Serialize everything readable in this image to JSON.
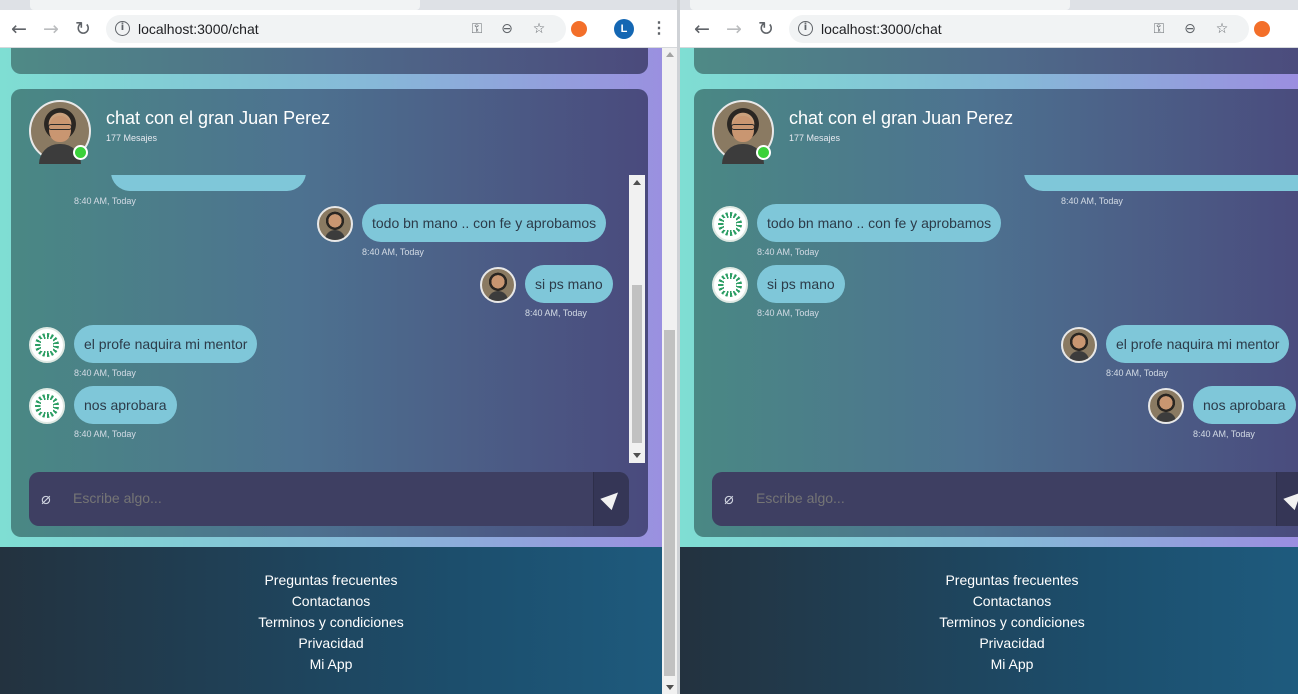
{
  "browser": {
    "url": "localhost:3000/chat",
    "profile_initial": "L",
    "icons": [
      "back-arrow-icon",
      "forward-arrow-icon",
      "reload-icon",
      "info-icon",
      "key-icon",
      "zoom-out-icon",
      "star-icon",
      "extension-icon",
      "menu-icon"
    ]
  },
  "chat": {
    "title": "chat con el gran Juan Perez",
    "message_count": "177 Mesajes",
    "input_placeholder": "Escribe algo...",
    "partial_time": "8:40 AM, Today"
  },
  "messages": [
    {
      "text": "todo bn mano .. con fe y aprobamos",
      "time": "8:40 AM, Today",
      "left_view": "sent",
      "right_view": "received"
    },
    {
      "text": "si ps mano",
      "time": "8:40 AM, Today",
      "left_view": "sent",
      "right_view": "received"
    },
    {
      "text": "el profe naquira mi mentor",
      "time": "8:40 AM, Today",
      "left_view": "received",
      "right_view": "sent"
    },
    {
      "text": "nos aprobara",
      "time": "8:40 AM, Today",
      "left_view": "received",
      "right_view": "sent"
    }
  ],
  "footer": {
    "links": [
      "Preguntas frecuentes",
      "Contactanos",
      "Terminos y condiciones",
      "Privacidad",
      "Mi App"
    ]
  },
  "colors": {
    "bubble": "#7fc7d9",
    "online": "#3ad13a",
    "composer": "#3e3f62",
    "footer": "#1c4f6e"
  }
}
